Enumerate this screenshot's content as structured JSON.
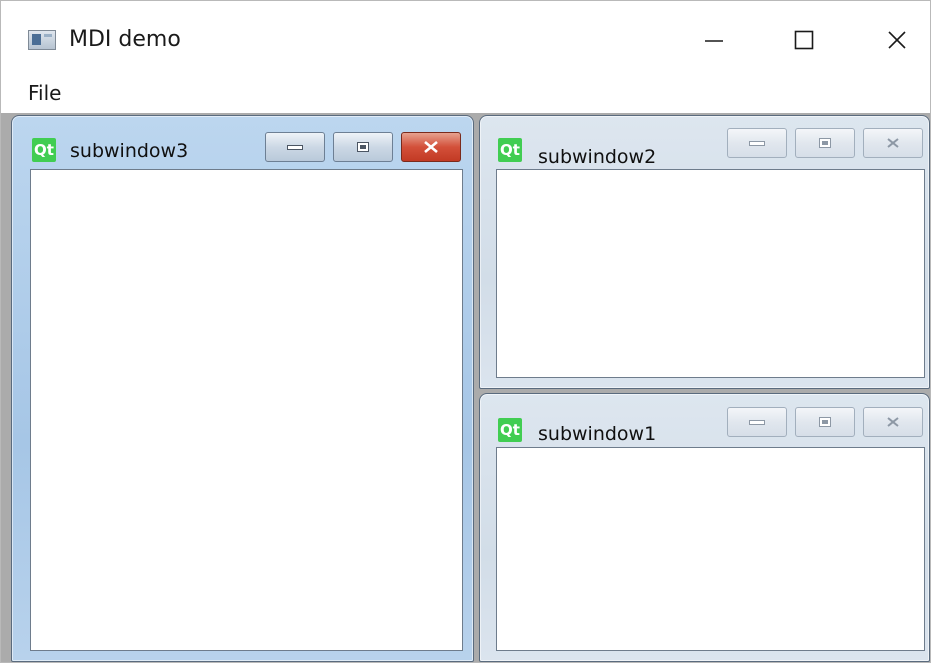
{
  "window": {
    "title": "MDI demo",
    "controls": {
      "minimize": "minimize-icon",
      "maximize": "maximize-icon",
      "close": "close-icon"
    }
  },
  "menubar": {
    "items": [
      "File"
    ]
  },
  "subwindows": [
    {
      "title": "subwindow3",
      "logo": "Qt",
      "state": "active"
    },
    {
      "title": "subwindow2",
      "logo": "Qt",
      "state": "inactive"
    },
    {
      "title": "subwindow1",
      "logo": "Qt",
      "state": "inactive"
    }
  ],
  "colors": {
    "mdi_background": "#ababab",
    "qt_green": "#41cd52",
    "close_active": "#c23a24"
  }
}
